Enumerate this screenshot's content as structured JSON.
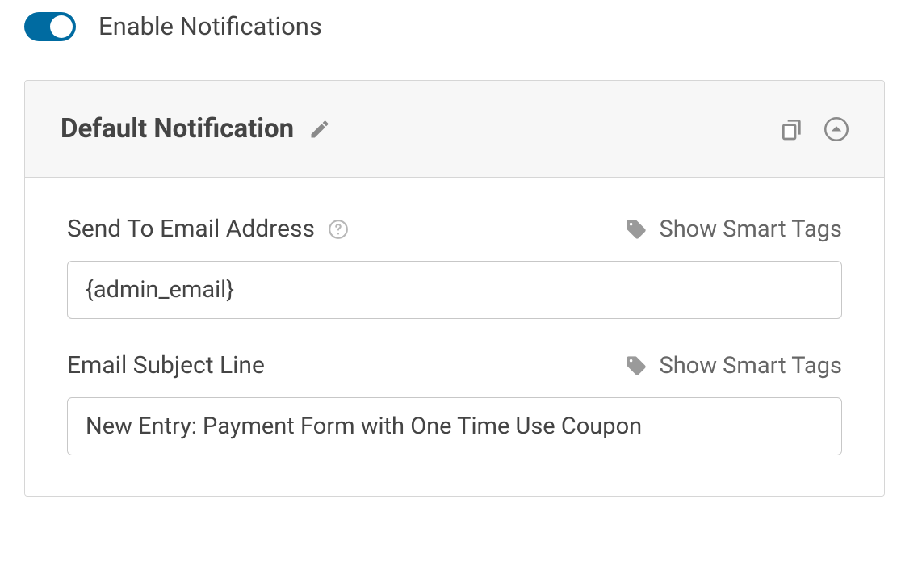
{
  "enable_notifications": {
    "label": "Enable Notifications",
    "value": true
  },
  "notification": {
    "title": "Default Notification",
    "fields": {
      "send_to": {
        "label": "Send To Email Address",
        "value": "{admin_email}",
        "smart_tags_label": "Show Smart Tags"
      },
      "subject": {
        "label": "Email Subject Line",
        "value": "New Entry: Payment Form with One Time Use Coupon",
        "smart_tags_label": "Show Smart Tags"
      }
    }
  }
}
